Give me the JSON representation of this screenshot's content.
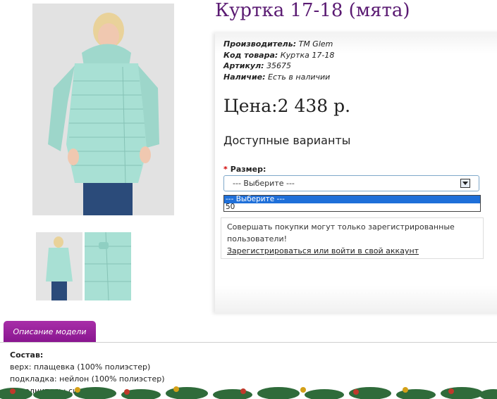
{
  "product": {
    "title": "Куртка 17-18 (мята)",
    "meta": [
      {
        "key": "Производитель:",
        "value": "ТМ Glem"
      },
      {
        "key": "Код товара:",
        "value": "Куртка 17-18"
      },
      {
        "key": "Артикул:",
        "value": "35675"
      },
      {
        "key": "Наличие:",
        "value": "Есть в наличии"
      }
    ],
    "price": "Цена:2 438 р."
  },
  "variants": {
    "title": "Доступные варианты",
    "size_label": "Размер:",
    "required_mark": "*",
    "select_value": "--- Выберите ---",
    "options": [
      "--- Выберите ---",
      "50"
    ]
  },
  "notice": {
    "text": "Совершать покупки могут только зарегистрированные пользователи!",
    "link": "Зарегистрироваться или войти в свой аккаунт"
  },
  "tabs": {
    "description_label": "Описание модели"
  },
  "description": {
    "heading": "Состав:",
    "lines": [
      "верх: плащевка (100% полиэстер)",
      "подкладка: нейлон (100% полиэстер)",
      "наполнитель: синтепон"
    ]
  },
  "colors": {
    "title": "#5a1a72",
    "tab": "#8a1690",
    "jacket": "#a8e0d4",
    "jeans": "#2b4b7a"
  }
}
